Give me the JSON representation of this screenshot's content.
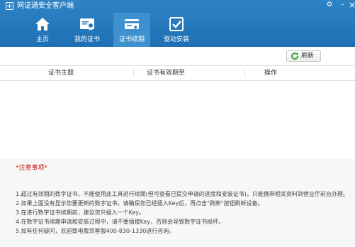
{
  "window": {
    "title": "网证通安全客户端",
    "settings_glyph": "⚙",
    "minimize_glyph": "–",
    "close_glyph": "×"
  },
  "nav": {
    "tabs": [
      {
        "label": "主页",
        "icon": "home-icon"
      },
      {
        "label": "我的证书",
        "icon": "certificate-icon"
      },
      {
        "label": "证书续期",
        "icon": "renew-card-icon",
        "active": true
      },
      {
        "label": "驱动安装",
        "icon": "checkbox-icon"
      }
    ]
  },
  "toolbar": {
    "refresh_label": "刷新"
  },
  "table": {
    "columns": [
      "证书主题",
      "证书有效期至",
      "操作"
    ],
    "rows": []
  },
  "notes": {
    "title": "*注意事项*",
    "items": [
      "1.超过有效期的数字证书，不能使用此工具进行续期(但可查看已提交申请的进度和安装证书)，只能携带相关资料到营业厅前台办理。",
      "2.如果上面没有显示您要更新的数字证书，请确保您已经插入Key后，再点击\"刷新\"按钮刷新设备。",
      "3.在进行数字证书续期前，建议您只插入一个Key。",
      "4.在数字证书续期申请和安装过程中，请不要插拔Key，否则会导致数字证书损坏。",
      "5.如有任何疑问，欢迎致电我司客服400-830-1330进行咨询。"
    ]
  },
  "colors": {
    "header": "#2278bc",
    "active_tab": "#3e91cf",
    "refresh_icon": "#3aaa35",
    "notes_title": "#cc1111"
  }
}
